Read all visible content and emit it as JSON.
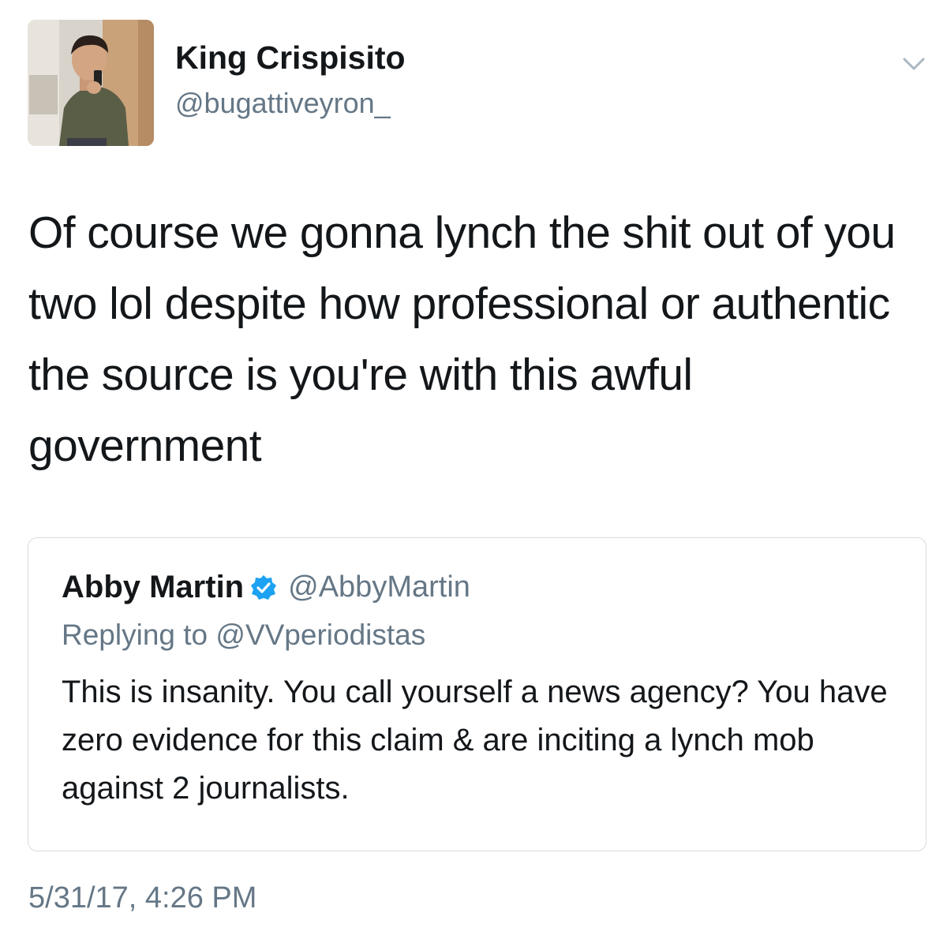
{
  "tweet": {
    "author": {
      "display_name": "King Crispisito",
      "handle": "@bugattiveyron_",
      "avatar": "profile-photo-selfie"
    },
    "menu_icon": "chevron-down-icon",
    "text": "Of course we gonna lynch the shit out of you two lol despite how professional or authentic the source is you're with this awful government",
    "quoted_tweet": {
      "display_name": "Abby Martin",
      "verified_icon": "verified-badge-icon",
      "handle": "@AbbyMartin",
      "replying_to": "Replying to @VVperiodistas",
      "text": "This is insanity. You call yourself a news agency? You have zero evidence for this claim & are inciting a lynch mob against 2 journalists."
    },
    "timestamp": "5/31/17, 4:26 PM"
  },
  "colors": {
    "text_primary": "#14171a",
    "text_secondary": "#657786",
    "verified_blue": "#1da1f2",
    "card_border": "#d6dce2"
  }
}
